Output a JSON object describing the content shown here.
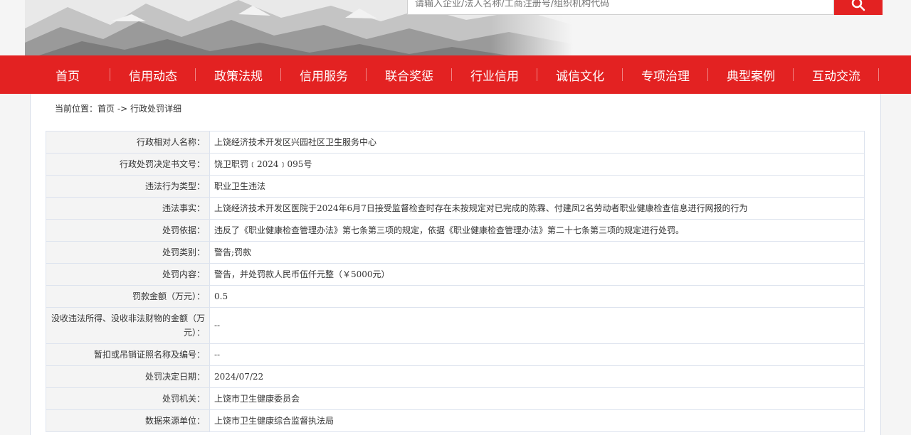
{
  "search": {
    "placeholder": "请输入企业/法人名称/工商注册号/组织机构代码"
  },
  "nav": {
    "items": [
      {
        "label": "首页"
      },
      {
        "label": "信用动态"
      },
      {
        "label": "政策法规"
      },
      {
        "label": "信用服务"
      },
      {
        "label": "联合奖惩"
      },
      {
        "label": "行业信用"
      },
      {
        "label": "诚信文化"
      },
      {
        "label": "专项治理"
      },
      {
        "label": "典型案例"
      },
      {
        "label": "互动交流"
      }
    ]
  },
  "breadcrumb": {
    "prefix": "当前位置：",
    "home": "首页",
    "separator": " -> ",
    "current": "行政处罚详细"
  },
  "detail": {
    "rows": [
      {
        "label": "行政相对人名称：",
        "value": "上饶经济技术开发区兴园社区卫生服务中心"
      },
      {
        "label": "行政处罚决定书文号：",
        "value": "饶卫职罚﹝2024﹞095号"
      },
      {
        "label": "违法行为类型：",
        "value": "职业卫生违法"
      },
      {
        "label": "违法事实：",
        "value": "上饶经济技术开发区医院于2024年6月7日接受监督检查时存在未按规定对已完成的陈霖、付建凤2名劳动者职业健康检查信息进行网报的行为"
      },
      {
        "label": "处罚依据：",
        "value": "违反了《职业健康检查管理办法》第七条第三项的规定，依据《职业健康检查管理办法》第二十七条第三项的规定进行处罚。"
      },
      {
        "label": "处罚类别：",
        "value": "警告;罚款"
      },
      {
        "label": "处罚内容：",
        "value": "警告，并处罚款人民币伍仟元整（￥5000元）"
      },
      {
        "label": "罚款金额（万元）：",
        "value": "0.5"
      },
      {
        "label": "没收违法所得、没收非法财物的金额（万元）：",
        "value": "--"
      },
      {
        "label": "暂扣或吊销证照名称及编号：",
        "value": "--"
      },
      {
        "label": "处罚决定日期：",
        "value": "2024/07/22"
      },
      {
        "label": "处罚机关：",
        "value": "上饶市卫生健康委员会"
      },
      {
        "label": "数据来源单位：",
        "value": "上饶市卫生健康综合监督执法局"
      }
    ]
  },
  "colors": {
    "brand_red": "#e32222",
    "page_bg": "#f5f5f5",
    "label_bg": "#f4f4f4",
    "table_border": "#dde3ee"
  }
}
